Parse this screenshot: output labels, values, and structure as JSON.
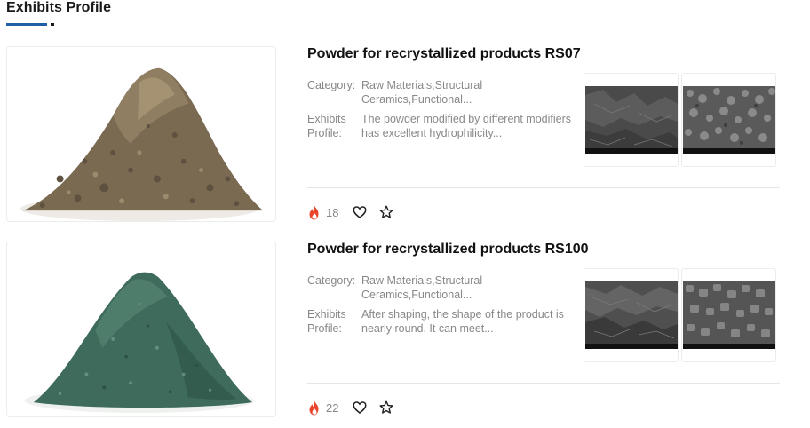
{
  "section": {
    "title": "Exhibits Profile"
  },
  "colors": {
    "accent": "#1e5fa8",
    "fire": "#e8452c"
  },
  "products": [
    {
      "title": "Powder for recrystallized products RS07",
      "category_label": "Category:",
      "category_value": "Raw Materials,Structural Ceramics,Functional...",
      "profile_label": "Exhibits Profile:",
      "profile_value": "The powder modified by different modifiers has excellent hydrophilicity...",
      "views": "18",
      "image": "brown-powder-pile",
      "sem_images": [
        "sem-micrograph-1",
        "sem-micrograph-2"
      ]
    },
    {
      "title": "Powder for recrystallized products RS100",
      "category_label": "Category:",
      "category_value": "Raw Materials,Structural Ceramics,Functional...",
      "profile_label": "Exhibits Profile:",
      "profile_value": "After shaping, the shape of the product is nearly round. It can meet...",
      "views": "22",
      "image": "green-powder-pile",
      "sem_images": [
        "sem-micrograph-3",
        "sem-micrograph-4"
      ]
    }
  ]
}
